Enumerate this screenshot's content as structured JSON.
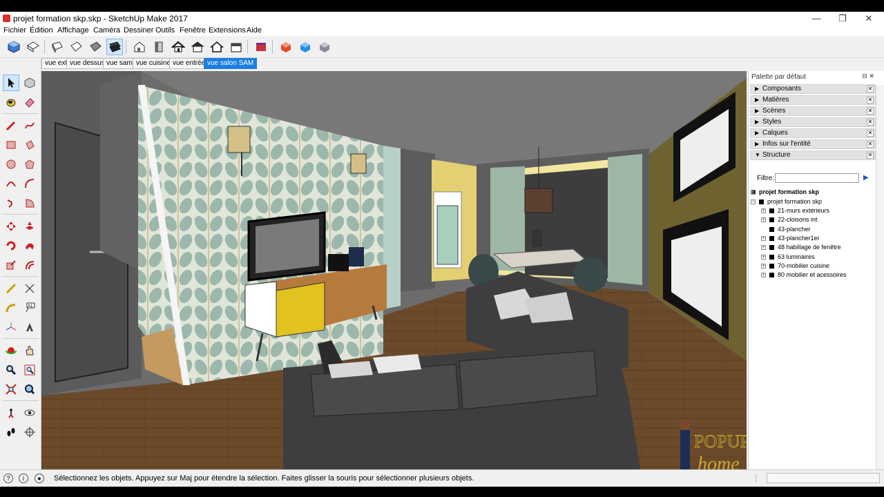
{
  "window": {
    "title": "projet formation skp.skp - SketchUp Make 2017",
    "minimize": "—",
    "maximize": "❐",
    "close": "✕"
  },
  "menu": [
    "Fichier",
    "Édition",
    "Affichage",
    "Caméra",
    "Dessiner",
    "Outils",
    "Fenêtre",
    "Extensions",
    "Aide"
  ],
  "toolbar_icons": [
    "iso-view-icon",
    "top-view-icon",
    "front-view-icon",
    "right-view-icon",
    "back-view-icon",
    "left-view-icon",
    "house-iso-icon",
    "wall-icon",
    "house-front-icon",
    "house-roof-icon",
    "house-outline-icon",
    "house-side-icon",
    "extension-warehouse-icon",
    "layout-red-icon",
    "layout-blue-icon",
    "layout-grey-icon"
  ],
  "scenes": [
    "vue ext",
    "vue dessus",
    "vue sam",
    "vue cuisine",
    "vue entrée",
    "vue salon SAM"
  ],
  "active_scene": "vue salon SAM",
  "left_tools": [
    "select-icon",
    "make-component-icon",
    "paint-bucket-icon",
    "eraser-icon",
    "pencil-icon",
    "freehand-icon",
    "rectangle-icon",
    "rotated-rectangle-icon",
    "circle-icon",
    "polygon-icon",
    "arc-icon",
    "two-point-arc-icon",
    "three-point-arc-icon",
    "pie-icon",
    "move-icon",
    "push-pull-icon",
    "rotate-icon",
    "follow-me-icon",
    "scale-icon",
    "offset-icon",
    "tape-measure-icon",
    "dimension-icon",
    "protractor-icon",
    "text-icon",
    "axes-icon",
    "3d-text-icon",
    "orbit-icon",
    "pan-icon",
    "zoom-icon",
    "zoom-window-icon",
    "zoom-extents-icon",
    "previous-view-icon",
    "position-camera-icon",
    "look-around-icon",
    "walk-icon",
    "section-plane-icon"
  ],
  "panel": {
    "title": "Palette par défaut",
    "trays": [
      {
        "label": "Composants",
        "expanded": false
      },
      {
        "label": "Matières",
        "expanded": false
      },
      {
        "label": "Scènes",
        "expanded": false
      },
      {
        "label": "Styles",
        "expanded": false
      },
      {
        "label": "Calques",
        "expanded": false
      },
      {
        "label": "Infos sur l'entité",
        "expanded": false
      },
      {
        "label": "Structure",
        "expanded": true
      }
    ],
    "filter_label": "Filtre:",
    "filter_value": "",
    "outliner_root": "projet formation skp",
    "outliner_model": "projet formation skp",
    "outliner_items": [
      {
        "label": "21-murs extérieurs",
        "expandable": true
      },
      {
        "label": "22-cloisons int",
        "expandable": true
      },
      {
        "label": "43-plancher",
        "expandable": false
      },
      {
        "label": "43-plancher1er",
        "expandable": true
      },
      {
        "label": "48 habillage de fenêtre",
        "expandable": true
      },
      {
        "label": "63 luminaires",
        "expandable": true
      },
      {
        "label": "70-mobilier cuisine",
        "expandable": true
      },
      {
        "label": "80 mobilier et acessoires",
        "expandable": true
      }
    ]
  },
  "status": {
    "text": "Sélectionnez les objets. Appuyez sur Maj pour étendre la sélection. Faites glisser la souris pour sélectionner plusieurs objets.",
    "measurements": ""
  },
  "watermark": {
    "line1": "POPUP",
    "line2": "home"
  },
  "colors": {
    "accent": "#1a7fe0",
    "floor": "#6b4a2b",
    "wall_grey": "#5f5f5f",
    "wall_olive": "#6e6330",
    "wallpaper_bg": "#dfe6d8",
    "wallpaper_leaf": "#9cb7ac",
    "sofa": "#3e3e40"
  }
}
